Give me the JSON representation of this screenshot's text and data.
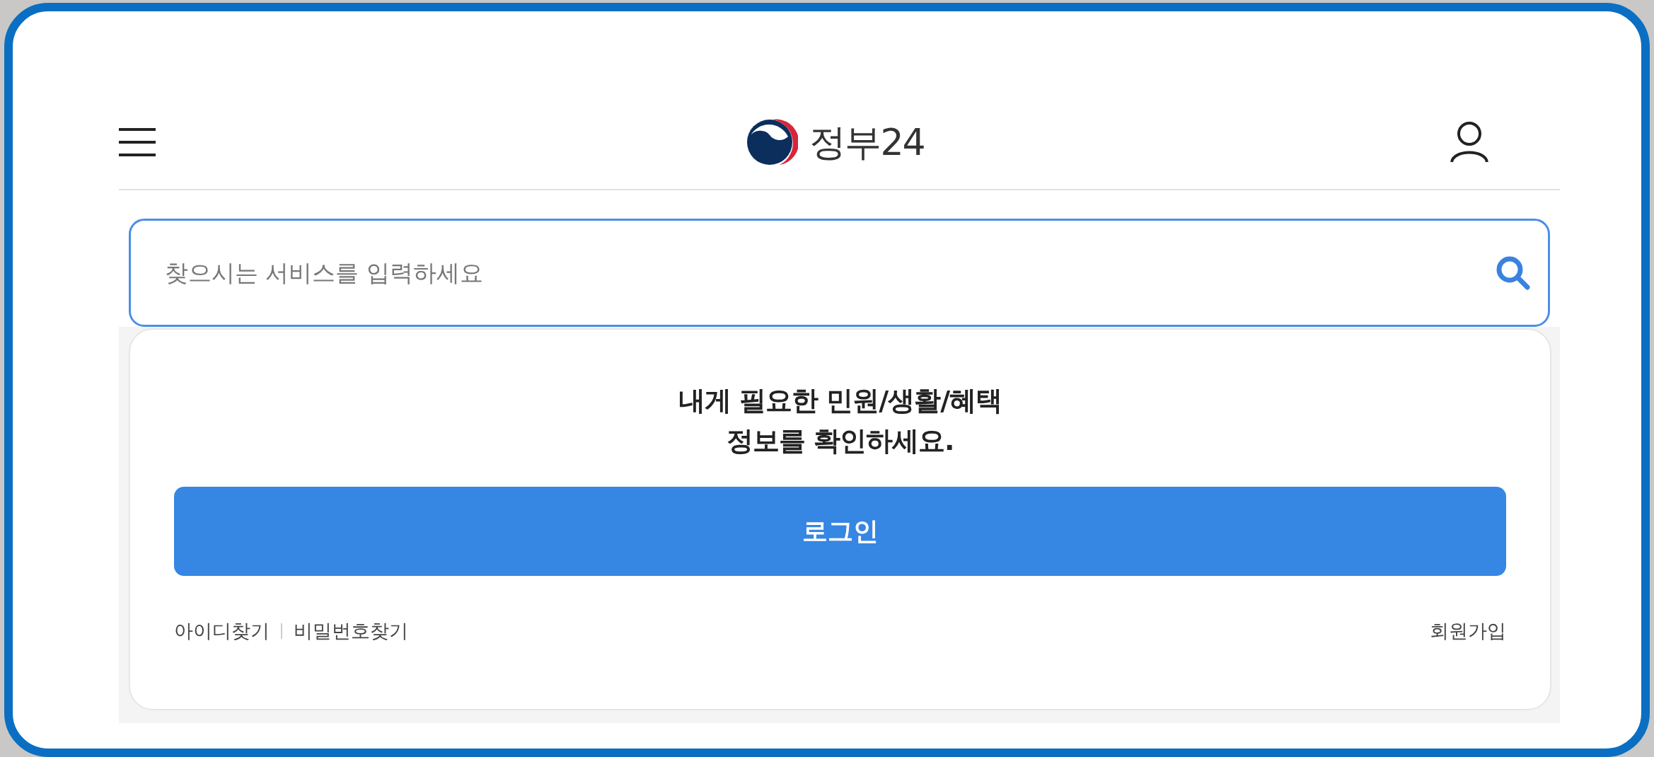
{
  "header": {
    "logo_text": "정부24"
  },
  "search": {
    "placeholder": "찾으시는 서비스를 입력하세요"
  },
  "login_card": {
    "heading": "내게 필요한 민원/생활/혜택\n정보를 확인하세요.",
    "login_button": "로그인",
    "left_links": [
      "아이디찾기",
      "비밀번호찾기"
    ],
    "right_link": "회원가입"
  }
}
